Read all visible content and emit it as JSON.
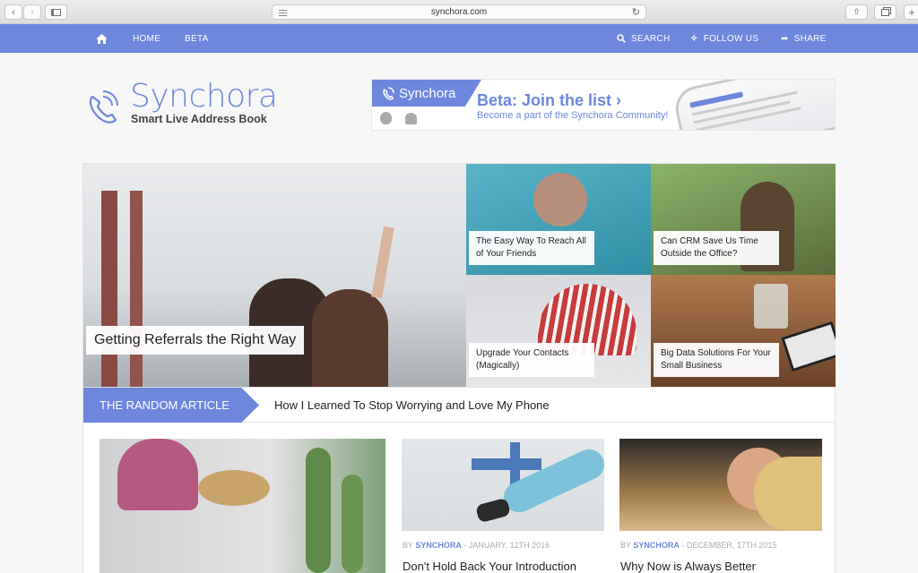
{
  "browser": {
    "url": "synchora.com"
  },
  "nav": {
    "home_icon": "home-icon",
    "items": [
      "HOME",
      "BETA"
    ],
    "search": "SEARCH",
    "follow": "FOLLOW US",
    "share": "SHARE"
  },
  "logo": {
    "title": "Synchora",
    "subtitle": "Smart Live Address Book"
  },
  "banner": {
    "tab": "Synchora",
    "headline": "Beta: Join the list ›",
    "subline": "Become a part of the Synchora Community!"
  },
  "featured": {
    "main": "Getting Referrals the Right Way",
    "tiles": [
      "The Easy Way To Reach All of Your Friends",
      "Can CRM Save Us Time Outside the Office?",
      "Upgrade Your Contacts (Magically)",
      "Big Data Solutions For Your Small Business"
    ]
  },
  "random": {
    "tag": "THE RANDOM ARTICLE",
    "title": "How I Learned To Stop Worrying and Love My Phone"
  },
  "articles": [
    {
      "by": "BY",
      "author": "SYNCHORA",
      "date": "- JANUARY, 12TH 2016",
      "title": "Don't Hold Back Your Introduction"
    },
    {
      "by": "BY",
      "author": "SYNCHORA",
      "date": "- DECEMBER, 17TH 2015",
      "title": "Why Now is Always Better"
    }
  ],
  "colors": {
    "brand": "#6d87dd"
  }
}
